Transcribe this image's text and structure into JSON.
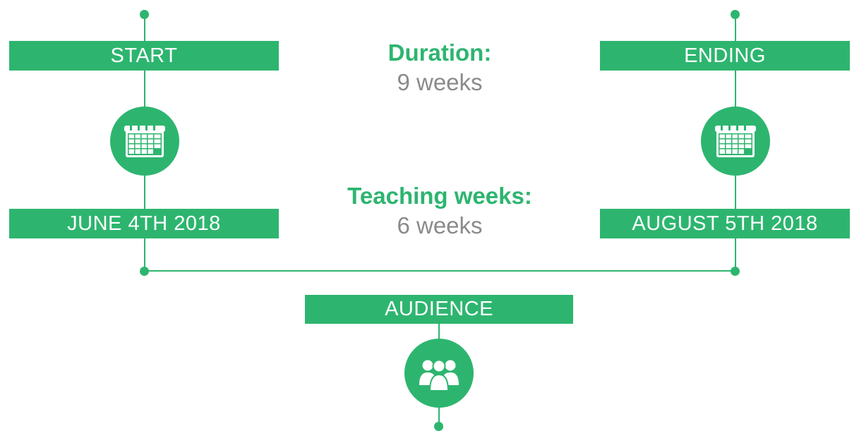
{
  "start": {
    "label": "START",
    "date": "JUNE 4TH 2018",
    "icon": "calendar-icon"
  },
  "ending": {
    "label": "ENDING",
    "date": "AUGUST 5TH 2018",
    "icon": "calendar-icon"
  },
  "duration": {
    "title": "Duration:",
    "value": "9 weeks"
  },
  "teaching": {
    "title": "Teaching weeks:",
    "value": "6 weeks"
  },
  "audience": {
    "label": "AUDIENCE",
    "icon": "people-group-icon"
  },
  "colors": {
    "accent": "#2db56f",
    "text_gray": "#8a8a8a",
    "background": "#ffffff"
  }
}
